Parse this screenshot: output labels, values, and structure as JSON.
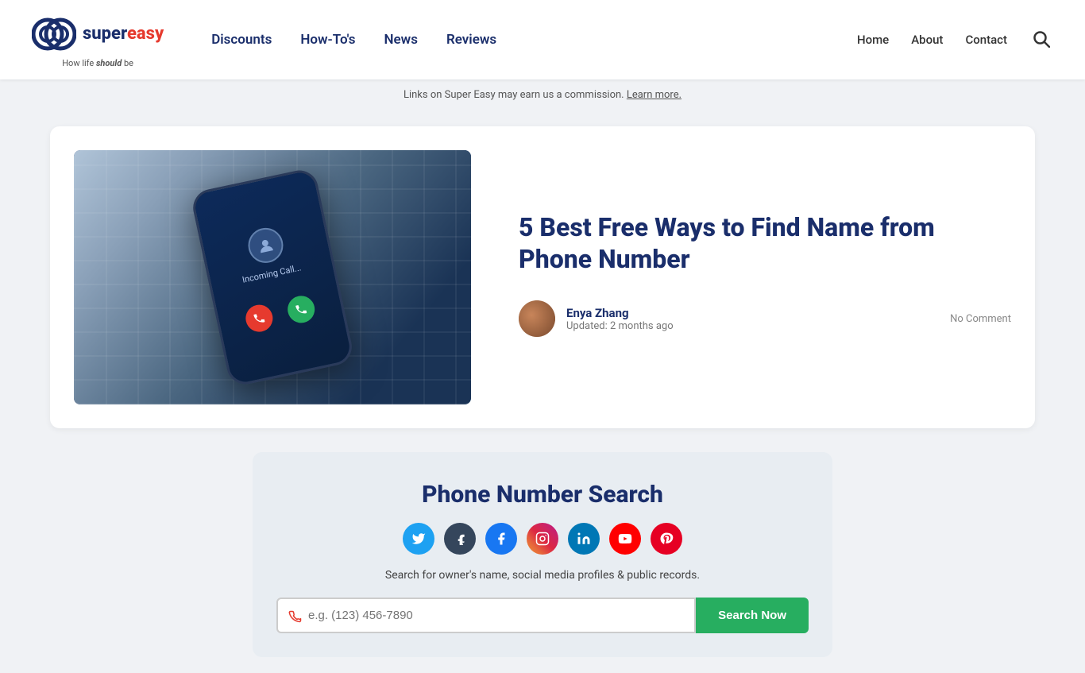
{
  "header": {
    "logo_super": "super",
    "logo_easy": "easy",
    "logo_tagline_prefix": "How life ",
    "logo_tagline_bold": "should",
    "logo_tagline_suffix": " be",
    "nav": {
      "items": [
        {
          "label": "Discounts",
          "href": "#"
        },
        {
          "label": "How-To's",
          "href": "#"
        },
        {
          "label": "News",
          "href": "#"
        },
        {
          "label": "Reviews",
          "href": "#"
        }
      ]
    },
    "right_nav": {
      "items": [
        {
          "label": "Home",
          "href": "#"
        },
        {
          "label": "About",
          "href": "#"
        },
        {
          "label": "Contact",
          "href": "#"
        }
      ]
    }
  },
  "banner": {
    "text": "Links on Super Easy may earn us a commission.",
    "learn_more": "Learn more."
  },
  "article": {
    "title": "5 Best Free Ways to Find Name from Phone Number",
    "author": "Enya Zhang",
    "updated": "Updated: 2 months ago",
    "no_comment": "No Comment",
    "phone_screen_text": "Incoming Call..."
  },
  "widget": {
    "title": "Phone Number Search",
    "description": "Search for owner's name, social media profiles & public records.",
    "search_placeholder": "e.g. (123) 456-7890",
    "search_button": "Search Now",
    "social_icons": [
      {
        "name": "twitter",
        "label": "T"
      },
      {
        "name": "tumblr",
        "label": "t"
      },
      {
        "name": "facebook",
        "label": "f"
      },
      {
        "name": "instagram",
        "label": "◻"
      },
      {
        "name": "linkedin",
        "label": "in"
      },
      {
        "name": "youtube",
        "label": "▶"
      },
      {
        "name": "pinterest",
        "label": "P"
      }
    ]
  }
}
